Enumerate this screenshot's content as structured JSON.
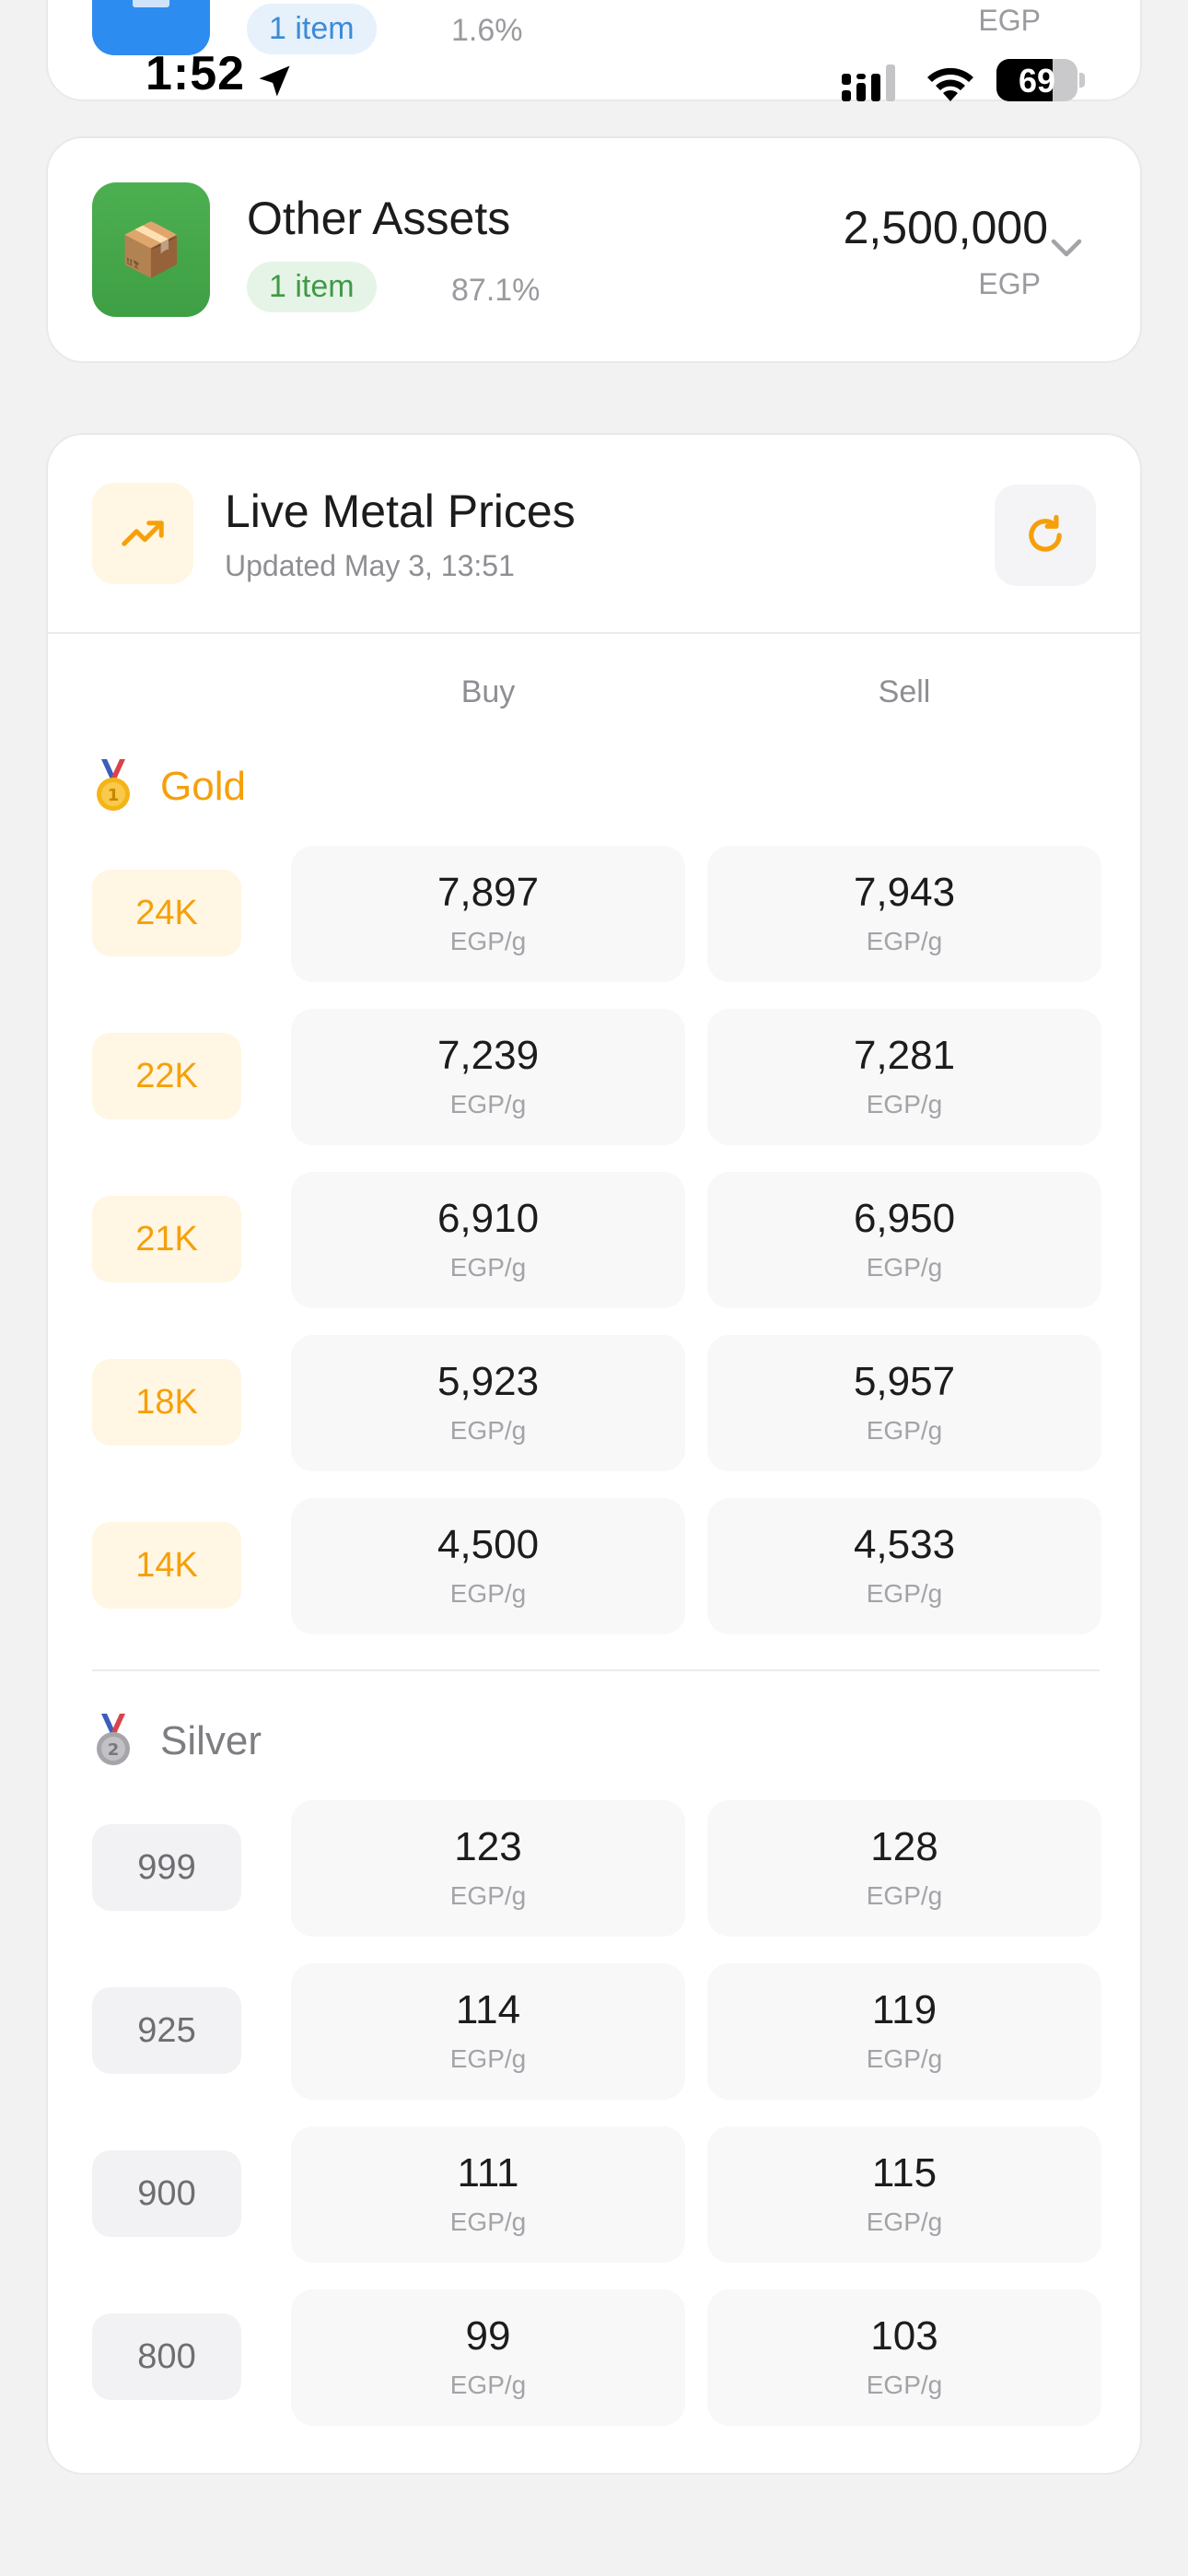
{
  "status_bar": {
    "time": "1:52",
    "battery": "69",
    "battery_level": 0.69
  },
  "top_card": {
    "badge": "1 item",
    "percent": "1.6%",
    "currency": "EGP"
  },
  "other_assets": {
    "title": "Other Assets",
    "badge": "1 item",
    "percent": "87.1%",
    "amount": "2,500,000",
    "currency": "EGP",
    "icon": "package-icon"
  },
  "metal_prices": {
    "title": "Live Metal Prices",
    "updated": "Updated May 3, 13:51",
    "buy_label": "Buy",
    "sell_label": "Sell",
    "unit": "EGP/g",
    "gold": {
      "label": "Gold",
      "rows": [
        {
          "karat": "24K",
          "buy": "7,897",
          "sell": "7,943"
        },
        {
          "karat": "22K",
          "buy": "7,239",
          "sell": "7,281"
        },
        {
          "karat": "21K",
          "buy": "6,910",
          "sell": "6,950"
        },
        {
          "karat": "18K",
          "buy": "5,923",
          "sell": "5,957"
        },
        {
          "karat": "14K",
          "buy": "4,500",
          "sell": "4,533"
        }
      ]
    },
    "silver": {
      "label": "Silver",
      "rows": [
        {
          "karat": "999",
          "buy": "123",
          "sell": "128"
        },
        {
          "karat": "925",
          "buy": "114",
          "sell": "119"
        },
        {
          "karat": "900",
          "buy": "111",
          "sell": "115"
        },
        {
          "karat": "800",
          "buy": "99",
          "sell": "103"
        }
      ]
    }
  },
  "colors": {
    "gold": "#f5a00a",
    "silver": "#7d7d82",
    "green": "#4caf50",
    "blue": "#2d8cf0"
  }
}
